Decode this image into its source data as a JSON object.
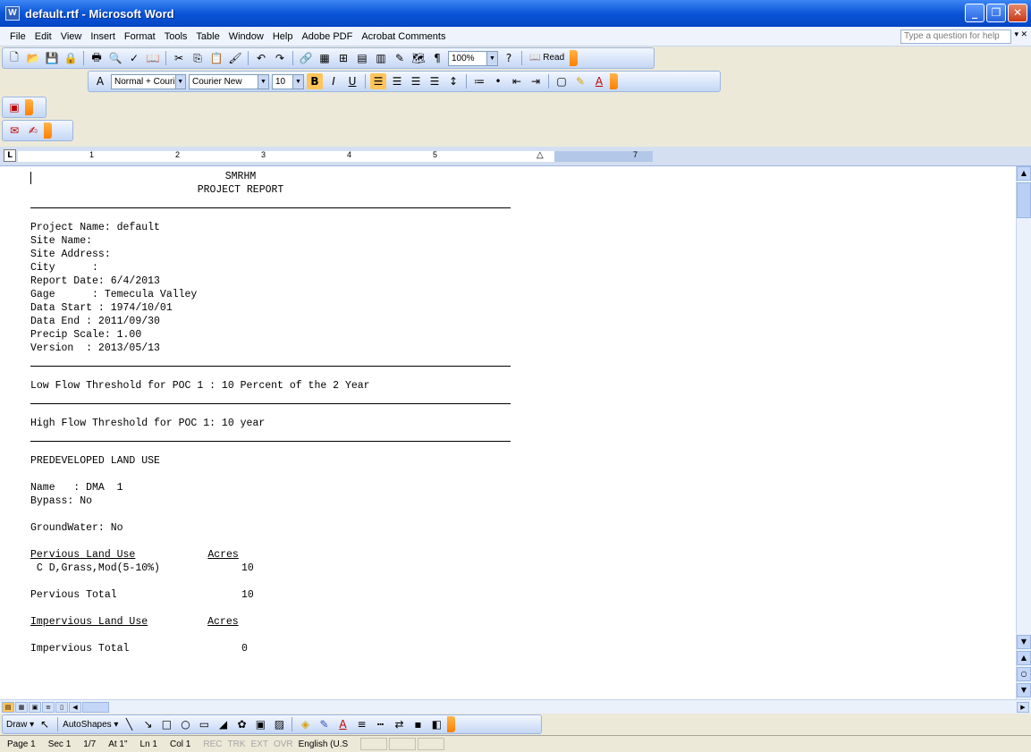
{
  "window": {
    "title": "default.rtf - Microsoft Word"
  },
  "menu": {
    "items": [
      "File",
      "Edit",
      "View",
      "Insert",
      "Format",
      "Tools",
      "Table",
      "Window",
      "Help",
      "Adobe PDF",
      "Acrobat Comments"
    ],
    "help_placeholder": "Type a question for help"
  },
  "toolbar": {
    "zoom": "100%",
    "read_label": "Read",
    "style": "Normal + Couri",
    "font": "Courier New",
    "size": "10"
  },
  "ruler": {
    "numbers": [
      "1",
      "2",
      "3",
      "4",
      "5",
      "7"
    ]
  },
  "document": {
    "heading1": "SMRHM",
    "heading2": "PROJECT REPORT",
    "project_lines": [
      "Project Name: default",
      "Site Name:",
      "Site Address:",
      "City      :",
      "Report Date: 6/4/2013",
      "Gage      : Temecula Valley",
      "Data Start : 1974/10/01",
      "Data End : 2011/09/30",
      "Precip Scale: 1.00",
      "Version  : 2013/05/13"
    ],
    "low_flow": "Low Flow Threshold for POC 1 : 10 Percent of the 2 Year",
    "high_flow": "High Flow Threshold for POC 1: 10 year",
    "predeveloped": "PREDEVELOPED LAND USE",
    "name_line": "Name   : DMA  1",
    "bypass_line": "Bypass: No",
    "groundwater_line": "GroundWater: No",
    "pervious_header": "Pervious Land Use",
    "acres_header": "Acres",
    "pervious_row_label": " C D,Grass,Mod(5-10%)",
    "pervious_row_value": "10",
    "pervious_total_label": "Pervious Total",
    "pervious_total_value": "10",
    "impervious_header": "Impervious Land Use",
    "impervious_acres_header": "Acres",
    "impervious_total_label": "Impervious Total",
    "impervious_total_value": "0"
  },
  "drawbar": {
    "draw_label": "Draw",
    "autoshapes_label": "AutoShapes"
  },
  "status": {
    "page": "Page 1",
    "sec": "Sec 1",
    "pages": "1/7",
    "at": "At 1\"",
    "ln": "Ln 1",
    "col": "Col 1",
    "rec": "REC",
    "trk": "TRK",
    "ext": "EXT",
    "ovr": "OVR",
    "language": "English (U.S"
  }
}
